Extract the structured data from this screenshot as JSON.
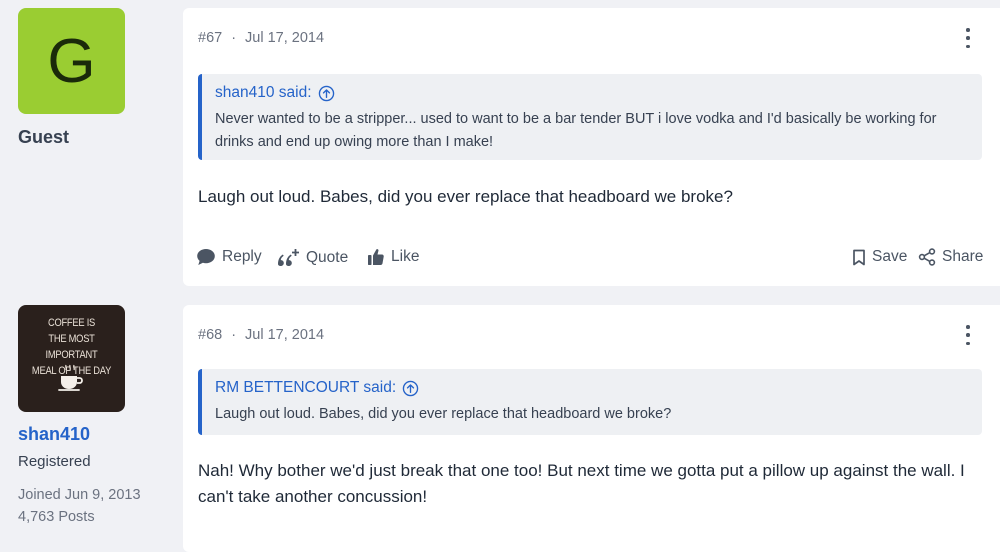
{
  "posts": [
    {
      "author": {
        "avatar_letter": "G",
        "name": "Guest"
      },
      "number": "#67",
      "date": "Jul 17, 2014",
      "quote": {
        "author": "shan410 said:",
        "text": "Never wanted to be a stripper... used to want to be a bar tender BUT i love vodka and I'd basically be working for drinks and end up owing more than I make!"
      },
      "body": "Laugh out loud. Babes, did you ever replace that headboard we broke?",
      "actions": {
        "reply": "Reply",
        "quote": "Quote",
        "like": "Like",
        "save": "Save",
        "share": "Share"
      }
    },
    {
      "author": {
        "avatar_caption": "COFFEE IS THE MOST IMPORTANT MEAL OF THE DAY",
        "name": "shan410",
        "title": "Registered",
        "joined": "Joined Jun 9, 2013",
        "posts": "4,763 Posts"
      },
      "number": "#68",
      "date": "Jul 17, 2014",
      "quote": {
        "author": "RM BETTENCOURT said:",
        "text": "Laugh out loud. Babes, did you ever replace that headboard we broke?"
      },
      "body": "Nah! Why bother we'd just break that one too! But next time we gotta put a pillow up against the wall. I can't take another concussion!"
    }
  ],
  "colors": {
    "accent": "#2563c9",
    "guest_avatar": "#9acd32",
    "page_bg": "#f0f1f5"
  }
}
